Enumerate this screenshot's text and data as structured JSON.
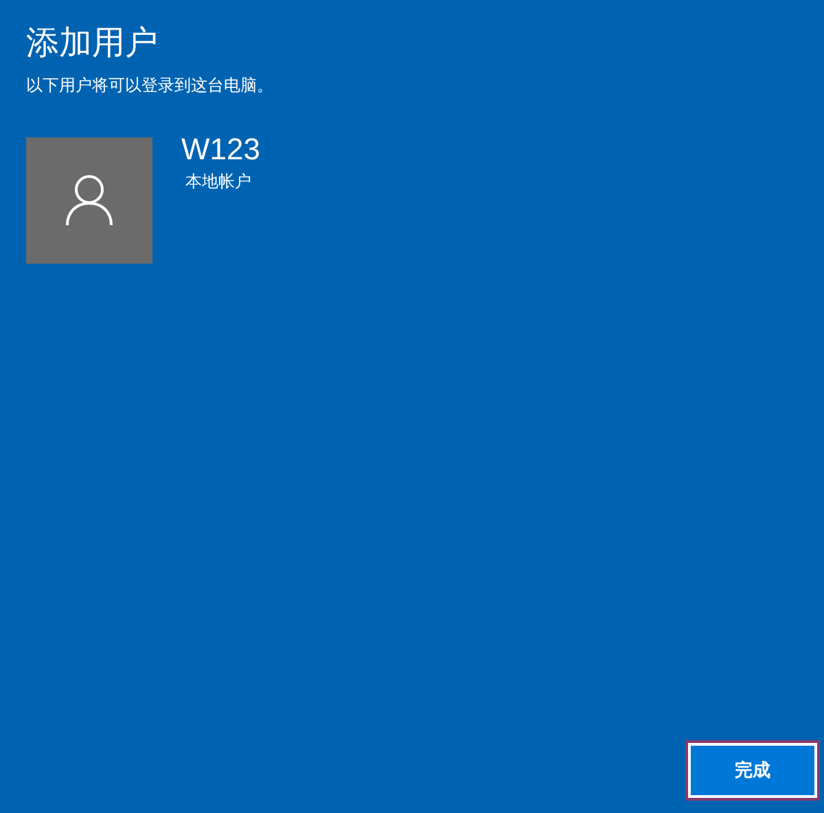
{
  "title": "添加用户",
  "subtitle": "以下用户将可以登录到这台电脑。",
  "users": [
    {
      "name": "W123",
      "account_type": "本地帐户"
    }
  ],
  "finish_button": {
    "label": "完成",
    "focused": true
  }
}
